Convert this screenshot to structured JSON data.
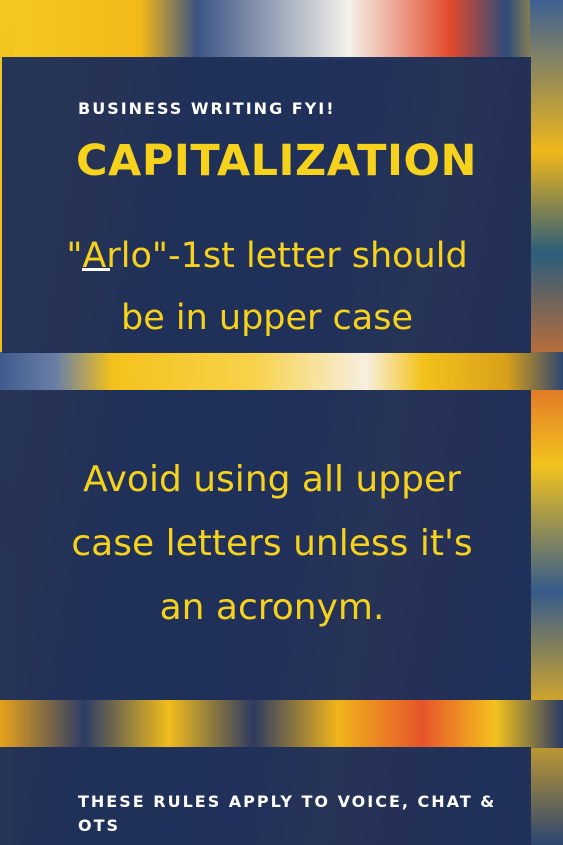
{
  "header": {
    "eyebrow": "BUSINESS WRITING FYI!",
    "title": "CAPITALIZATION"
  },
  "rule": {
    "line1": "\"Arlo\"-1st letter should",
    "line2": "be in upper case"
  },
  "advice": {
    "line1": "Avoid using all upper",
    "line2": "case letters unless it's",
    "line3": "an acronym."
  },
  "footer": {
    "line1": "THESE RULES APPLY TO VOICE, CHAT &",
    "line2": "OTS"
  },
  "colors": {
    "panel": "#1f3059",
    "accent_yellow": "#f6d21c",
    "text_white": "#ffffff"
  }
}
